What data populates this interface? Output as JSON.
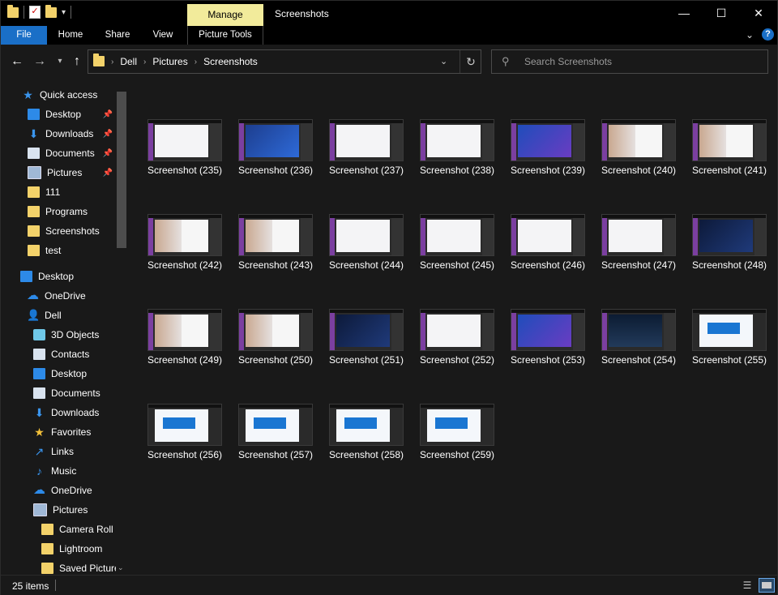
{
  "window": {
    "title": "Screenshots",
    "contextual_tab": "Manage",
    "controls": {
      "minimize": "—",
      "maximize": "☐",
      "close": "✕"
    }
  },
  "ribbon": {
    "tabs": [
      "File",
      "Home",
      "Share",
      "View",
      "Picture Tools"
    ]
  },
  "address": {
    "breadcrumbs": [
      "Dell",
      "Pictures",
      "Screenshots"
    ],
    "search_placeholder": "Search Screenshots"
  },
  "sidebar": {
    "items": [
      {
        "label": "Quick access",
        "icon": "star-icon",
        "pinned": false
      },
      {
        "label": "Desktop",
        "icon": "desktop-icon",
        "pinned": true
      },
      {
        "label": "Downloads",
        "icon": "download-icon",
        "pinned": true
      },
      {
        "label": "Documents",
        "icon": "document-icon",
        "pinned": true
      },
      {
        "label": "Pictures",
        "icon": "pictures-icon",
        "pinned": true
      },
      {
        "label": "111",
        "icon": "folder-icon",
        "pinned": false
      },
      {
        "label": "Programs",
        "icon": "folder-icon",
        "pinned": false
      },
      {
        "label": "Screenshots",
        "icon": "folder-icon",
        "pinned": false
      },
      {
        "label": "test",
        "icon": "folder-icon",
        "pinned": false
      },
      {
        "label": "Desktop",
        "icon": "desktop-icon",
        "pinned": false
      },
      {
        "label": "OneDrive",
        "icon": "cloud-icon",
        "pinned": false
      },
      {
        "label": "Dell",
        "icon": "user-icon",
        "pinned": false
      },
      {
        "label": "3D Objects",
        "icon": "3d-objects-icon",
        "pinned": false
      },
      {
        "label": "Contacts",
        "icon": "contacts-icon",
        "pinned": false
      },
      {
        "label": "Desktop",
        "icon": "desktop-icon",
        "pinned": false
      },
      {
        "label": "Documents",
        "icon": "document-icon",
        "pinned": false
      },
      {
        "label": "Downloads",
        "icon": "download-icon",
        "pinned": false
      },
      {
        "label": "Favorites",
        "icon": "favorites-icon",
        "pinned": false
      },
      {
        "label": "Links",
        "icon": "link-icon",
        "pinned": false
      },
      {
        "label": "Music",
        "icon": "music-icon",
        "pinned": false
      },
      {
        "label": "OneDrive",
        "icon": "cloud-icon",
        "pinned": false
      },
      {
        "label": "Pictures",
        "icon": "pictures-icon",
        "pinned": false
      },
      {
        "label": "Camera Roll",
        "icon": "folder-icon",
        "pinned": false
      },
      {
        "label": "Lightroom",
        "icon": "folder-icon",
        "pinned": false
      },
      {
        "label": "Saved Picture",
        "icon": "folder-icon",
        "pinned": false
      }
    ]
  },
  "files": [
    "Screenshot (235)",
    "Screenshot (236)",
    "Screenshot (237)",
    "Screenshot (238)",
    "Screenshot (239)",
    "Screenshot (240)",
    "Screenshot (241)",
    "Screenshot (242)",
    "Screenshot (243)",
    "Screenshot (244)",
    "Screenshot (245)",
    "Screenshot (246)",
    "Screenshot (247)",
    "Screenshot (248)",
    "Screenshot (249)",
    "Screenshot (250)",
    "Screenshot (251)",
    "Screenshot (252)",
    "Screenshot (253)",
    "Screenshot (254)",
    "Screenshot (255)",
    "Screenshot (256)",
    "Screenshot (257)",
    "Screenshot (258)",
    "Screenshot (259)"
  ],
  "status": {
    "item_count": "25 items"
  },
  "colors": {
    "accent": "#1a6fc7",
    "manage_tab": "#f2eb9b",
    "background": "#191919"
  }
}
